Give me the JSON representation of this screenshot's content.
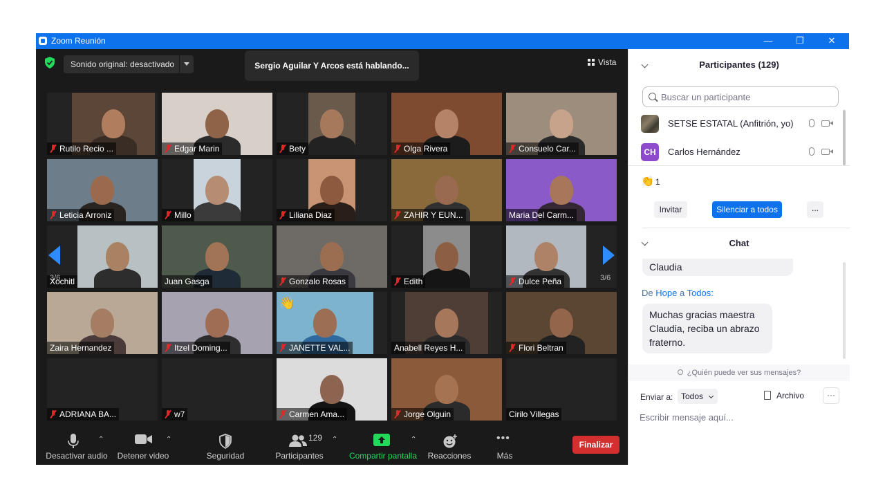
{
  "window": {
    "title": "Zoom Reunión",
    "controls": {
      "minimize": "—",
      "restore": "❐",
      "close": "✕"
    }
  },
  "meeting": {
    "sound_button": "Sonido original: desactivado",
    "speaking_banner": "Sergio Aguilar Y Arcos está hablando...",
    "view_label": "Vista",
    "page_left": "3/6",
    "page_right": "3/6",
    "hand_emoji": "👋",
    "tiles": [
      {
        "name": "Rutilo Recio ...",
        "muted": true
      },
      {
        "name": "Edgar Marin",
        "muted": true
      },
      {
        "name": "Bety",
        "muted": true
      },
      {
        "name": "Olga Rivera",
        "muted": true
      },
      {
        "name": "Consuelo Car...",
        "muted": true
      },
      {
        "name": "Leticia Arroniz",
        "muted": true
      },
      {
        "name": "Millo",
        "muted": true
      },
      {
        "name": "Liliana Diaz",
        "muted": true
      },
      {
        "name": "ZAHIR Y EUN...",
        "muted": true
      },
      {
        "name": "Maria Del Carm...",
        "muted": false
      },
      {
        "name": "Xochitl",
        "muted": false
      },
      {
        "name": "Juan Gasga",
        "muted": false
      },
      {
        "name": "Gonzalo Rosas",
        "muted": true
      },
      {
        "name": "Edith",
        "muted": true
      },
      {
        "name": "Dulce Peña",
        "muted": true
      },
      {
        "name": "Zaira Hernandez",
        "muted": false
      },
      {
        "name": "Itzel Doming...",
        "muted": true
      },
      {
        "name": "JANETTE VAL...",
        "muted": true
      },
      {
        "name": "Anabell Reyes H...",
        "muted": false
      },
      {
        "name": "Flori Beltran",
        "muted": true
      },
      {
        "name": "ADRIANA BA...",
        "muted": true
      },
      {
        "name": "w7",
        "muted": true
      },
      {
        "name": "Carmen Ama...",
        "muted": true
      },
      {
        "name": "Jorge Olguin",
        "muted": true
      },
      {
        "name": "Cirilo Villegas",
        "muted": false
      }
    ]
  },
  "toolbar": {
    "audio": "Desactivar audio",
    "video": "Detener video",
    "security": "Seguridad",
    "participants": "Participantes",
    "participants_count": "129",
    "share": "Compartir pantalla",
    "reactions": "Reacciones",
    "more": "Más",
    "end": "Finalizar",
    "share_color": "#23d959",
    "end_color": "#d32f2f"
  },
  "participants_panel": {
    "title": "Participantes (129)",
    "search_placeholder": "Buscar un participante",
    "list": [
      {
        "name": "SETSE ESTATAL (Anfitrión, yo)",
        "avatar": ""
      },
      {
        "name": "Carlos Hernández",
        "avatar": "CH"
      }
    ],
    "reaction_emoji": "👏",
    "reaction_count": "1",
    "invite": "Invitar",
    "mute_all": "Silenciar a todos",
    "more": "..."
  },
  "chat": {
    "title": "Chat",
    "prev_message_tail": "Claudia",
    "from_prefix": "De",
    "from": "Hope",
    "to_prefix": "a",
    "to": "Todos:",
    "message": "Muchas gracias maestra Claudia, reciba un abrazo fraterno.",
    "privacy_note": "¿Quién puede ver sus mensajes?",
    "send_to_label": "Enviar a:",
    "send_to_value": "Todos",
    "file_label": "Archivo",
    "more": "···",
    "input_placeholder": "Escribir mensaje aquí..."
  }
}
